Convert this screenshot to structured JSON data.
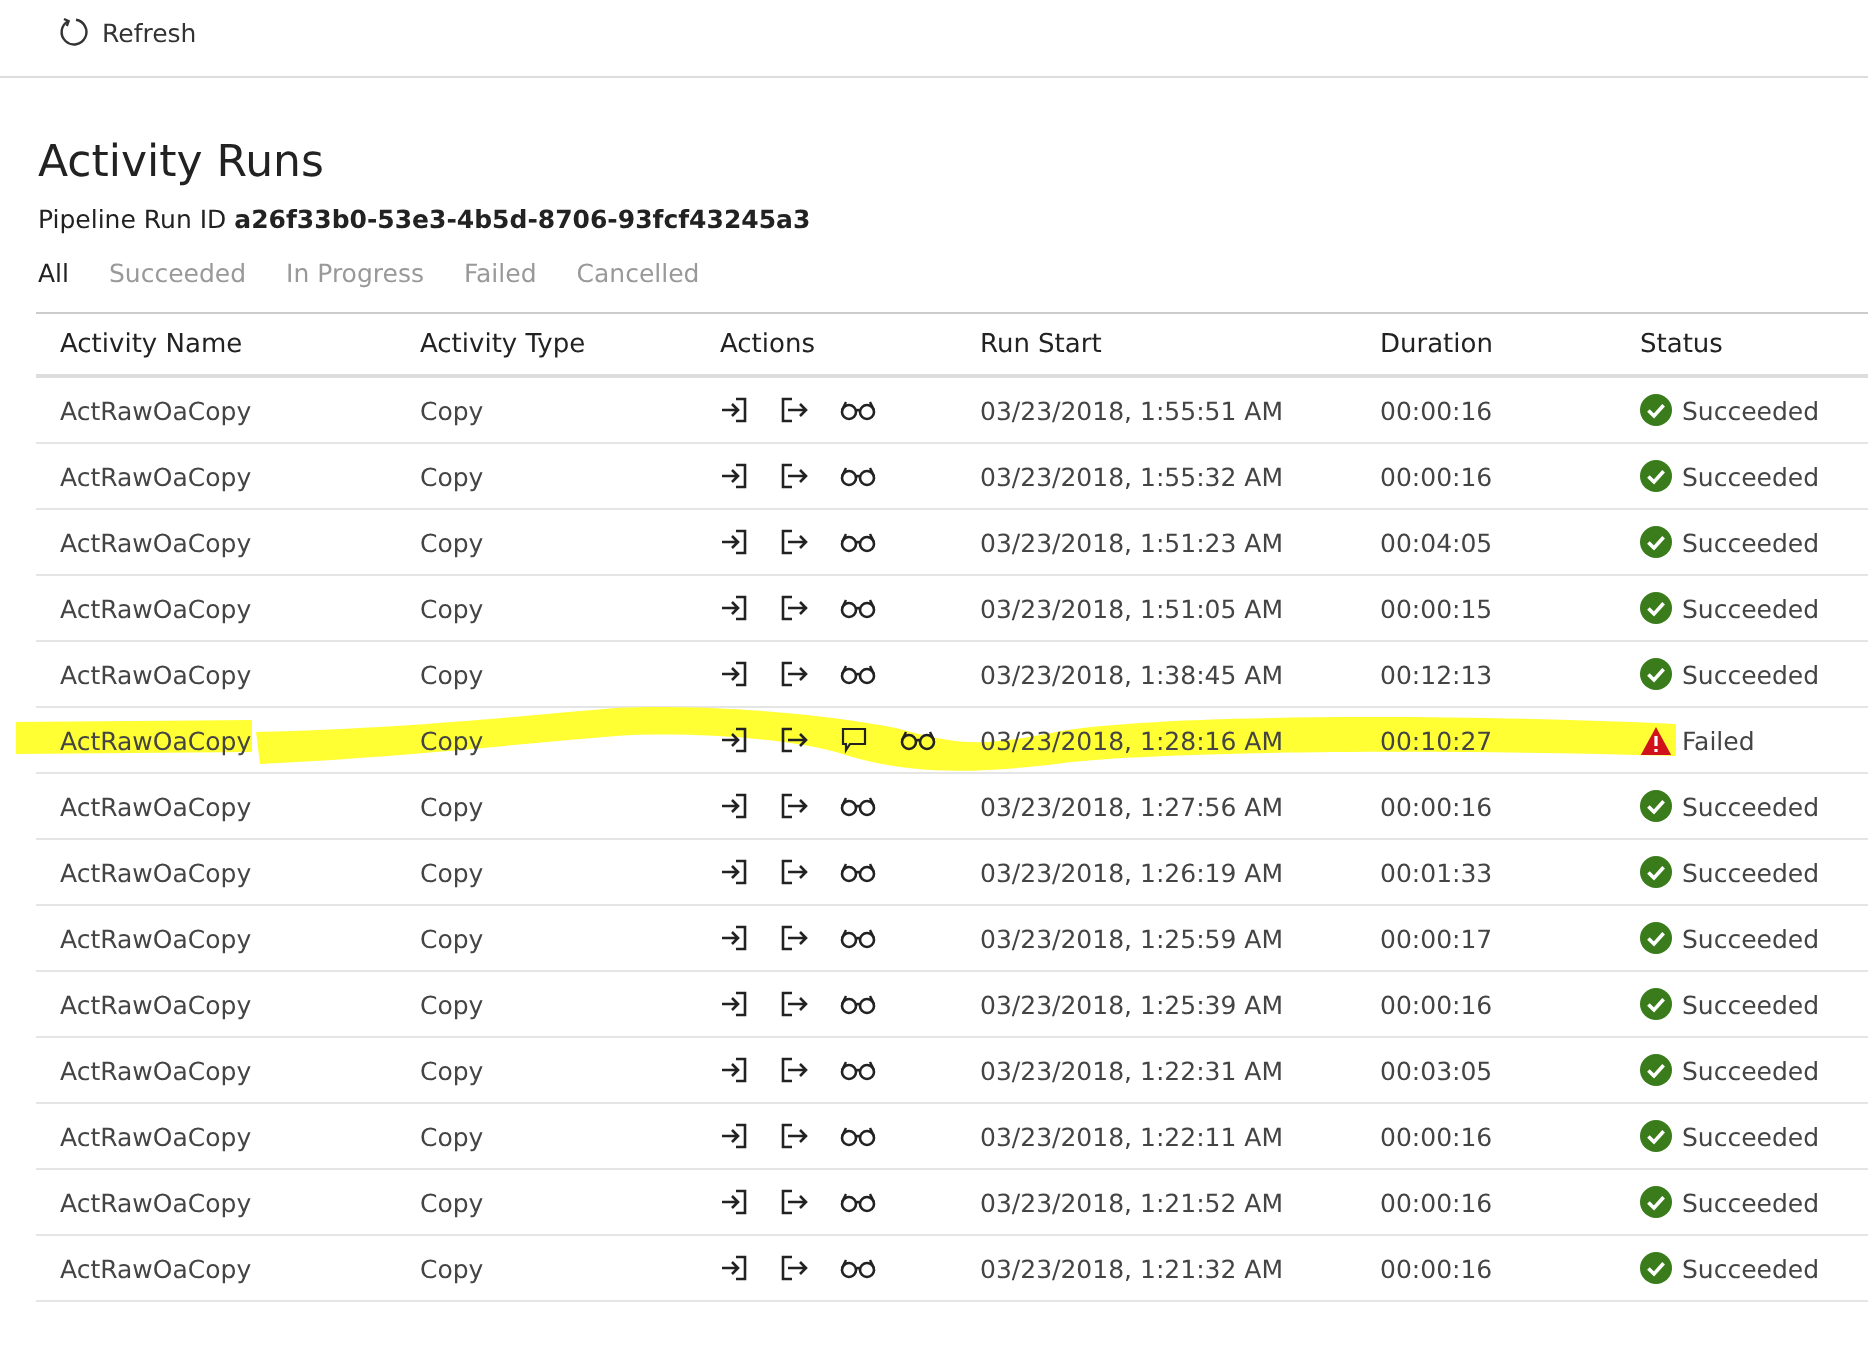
{
  "toolbar": {
    "refresh_label": "Refresh"
  },
  "title": "Activity Runs",
  "pipeline": {
    "label": "Pipeline Run ID",
    "id": "a26f33b0-53e3-4b5d-8706-93fcf43245a3"
  },
  "tabs": [
    {
      "label": "All",
      "selected": true
    },
    {
      "label": "Succeeded",
      "selected": false
    },
    {
      "label": "In Progress",
      "selected": false
    },
    {
      "label": "Failed",
      "selected": false
    },
    {
      "label": "Cancelled",
      "selected": false
    }
  ],
  "table": {
    "columns": [
      "Activity Name",
      "Activity Type",
      "Actions",
      "Run Start",
      "Duration",
      "Status"
    ],
    "rows": [
      {
        "name": "ActRawOaCopy",
        "type": "Copy",
        "details": false,
        "start": "03/23/2018, 1:55:51 AM",
        "duration": "00:00:16",
        "status": "Succeeded",
        "kind": "succeeded",
        "highlighted": false
      },
      {
        "name": "ActRawOaCopy",
        "type": "Copy",
        "details": false,
        "start": "03/23/2018, 1:55:32 AM",
        "duration": "00:00:16",
        "status": "Succeeded",
        "kind": "succeeded",
        "highlighted": false
      },
      {
        "name": "ActRawOaCopy",
        "type": "Copy",
        "details": false,
        "start": "03/23/2018, 1:51:23 AM",
        "duration": "00:04:05",
        "status": "Succeeded",
        "kind": "succeeded",
        "highlighted": false
      },
      {
        "name": "ActRawOaCopy",
        "type": "Copy",
        "details": false,
        "start": "03/23/2018, 1:51:05 AM",
        "duration": "00:00:15",
        "status": "Succeeded",
        "kind": "succeeded",
        "highlighted": false
      },
      {
        "name": "ActRawOaCopy",
        "type": "Copy",
        "details": false,
        "start": "03/23/2018, 1:38:45 AM",
        "duration": "00:12:13",
        "status": "Succeeded",
        "kind": "succeeded",
        "highlighted": false
      },
      {
        "name": "ActRawOaCopy",
        "type": "Copy",
        "details": true,
        "start": "03/23/2018, 1:28:16 AM",
        "duration": "00:10:27",
        "status": "Failed",
        "kind": "failed",
        "highlighted": true
      },
      {
        "name": "ActRawOaCopy",
        "type": "Copy",
        "details": false,
        "start": "03/23/2018, 1:27:56 AM",
        "duration": "00:00:16",
        "status": "Succeeded",
        "kind": "succeeded",
        "highlighted": false
      },
      {
        "name": "ActRawOaCopy",
        "type": "Copy",
        "details": false,
        "start": "03/23/2018, 1:26:19 AM",
        "duration": "00:01:33",
        "status": "Succeeded",
        "kind": "succeeded",
        "highlighted": false
      },
      {
        "name": "ActRawOaCopy",
        "type": "Copy",
        "details": false,
        "start": "03/23/2018, 1:25:59 AM",
        "duration": "00:00:17",
        "status": "Succeeded",
        "kind": "succeeded",
        "highlighted": false
      },
      {
        "name": "ActRawOaCopy",
        "type": "Copy",
        "details": false,
        "start": "03/23/2018, 1:25:39 AM",
        "duration": "00:00:16",
        "status": "Succeeded",
        "kind": "succeeded",
        "highlighted": false
      },
      {
        "name": "ActRawOaCopy",
        "type": "Copy",
        "details": false,
        "start": "03/23/2018, 1:22:31 AM",
        "duration": "00:03:05",
        "status": "Succeeded",
        "kind": "succeeded",
        "highlighted": false
      },
      {
        "name": "ActRawOaCopy",
        "type": "Copy",
        "details": false,
        "start": "03/23/2018, 1:22:11 AM",
        "duration": "00:00:16",
        "status": "Succeeded",
        "kind": "succeeded",
        "highlighted": false
      },
      {
        "name": "ActRawOaCopy",
        "type": "Copy",
        "details": false,
        "start": "03/23/2018, 1:21:52 AM",
        "duration": "00:00:16",
        "status": "Succeeded",
        "kind": "succeeded",
        "highlighted": false
      },
      {
        "name": "ActRawOaCopy",
        "type": "Copy",
        "details": false,
        "start": "03/23/2018, 1:21:32 AM",
        "duration": "00:00:16",
        "status": "Succeeded",
        "kind": "succeeded",
        "highlighted": false
      }
    ]
  }
}
